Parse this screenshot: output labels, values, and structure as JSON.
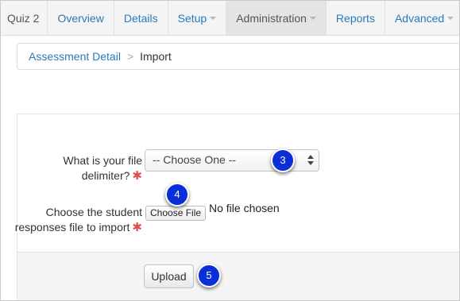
{
  "nav": {
    "brand": "Quiz 2",
    "items": [
      {
        "label": "Overview",
        "has_caret": false,
        "active": false
      },
      {
        "label": "Details",
        "has_caret": false,
        "active": false
      },
      {
        "label": "Setup",
        "has_caret": true,
        "active": false
      },
      {
        "label": "Administration",
        "has_caret": true,
        "active": true
      },
      {
        "label": "Reports",
        "has_caret": false,
        "active": false
      },
      {
        "label": "Advanced",
        "has_caret": true,
        "active": false
      }
    ]
  },
  "breadcrumb": {
    "parent": "Assessment Detail",
    "separator": ">",
    "current": "Import"
  },
  "form": {
    "delimiter_label": "What is your file delimiter?",
    "delimiter_selected": "-- Choose One --",
    "file_label": "Choose the student responses file to import",
    "file_button": "Choose File",
    "file_status": "No file chosen",
    "required_mark": "✱",
    "upload_label": "Upload"
  },
  "callouts": {
    "select_step": "3",
    "file_step": "4",
    "upload_step": "5"
  },
  "colors": {
    "link": "#2a7ab8",
    "required": "#d9534f",
    "callout": "#0a2fd6"
  }
}
